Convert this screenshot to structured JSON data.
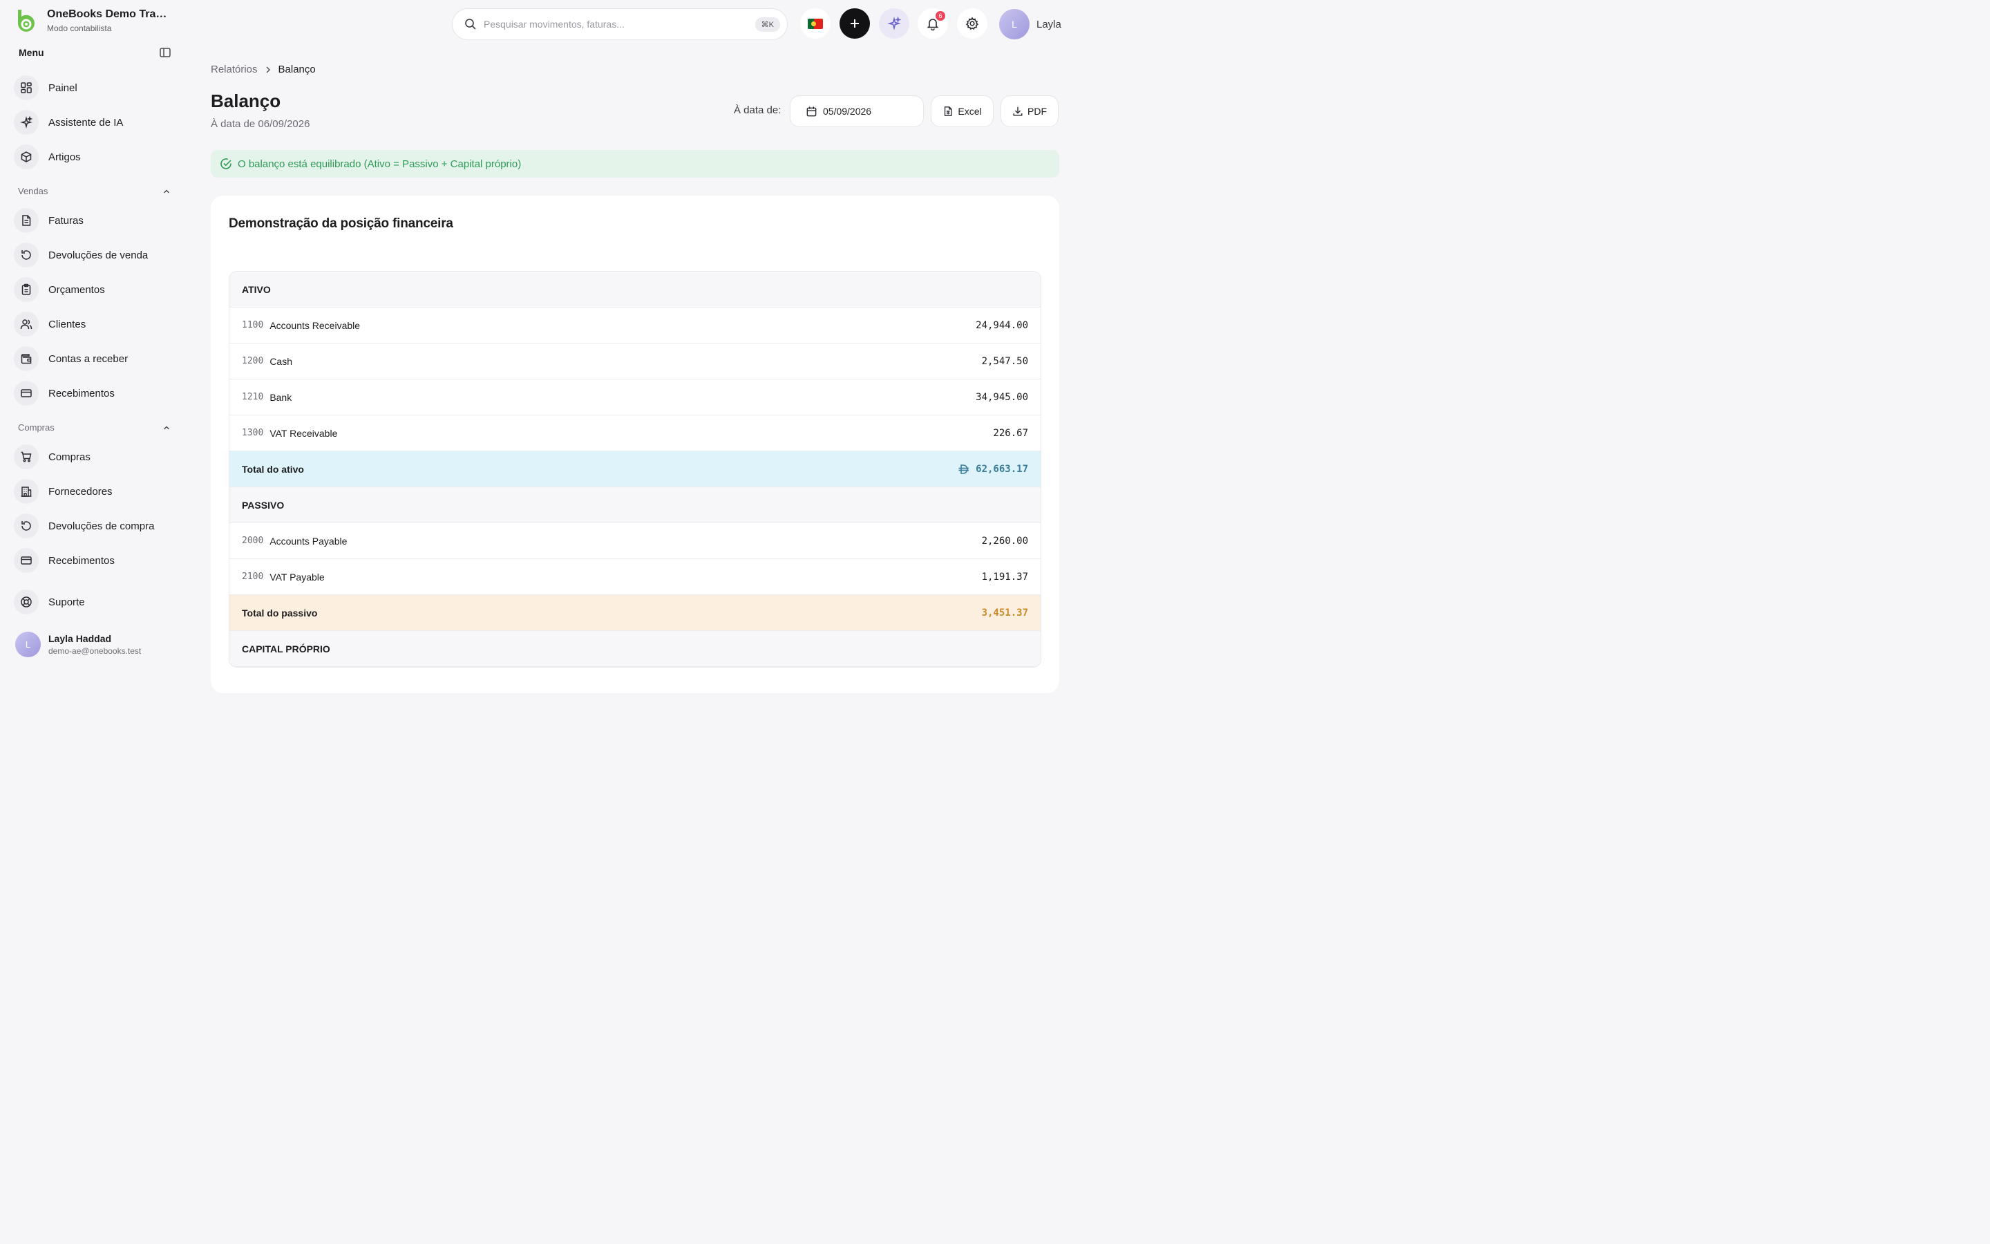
{
  "colors": {
    "brand": "#6cc24a",
    "accent_dark": "#121214",
    "success": "#2d9a55",
    "total_assets": "#3a7d98",
    "total_liabilities": "#c98a2a"
  },
  "brand": {
    "name": "OneBooks Demo Tradin...",
    "mode": "Modo contabilista"
  },
  "sidebar": {
    "menu_label": "Menu",
    "top_items": [
      {
        "label": "Painel",
        "icon": "dashboard-icon"
      },
      {
        "label": "Assistente de IA",
        "icon": "sparkle-icon"
      },
      {
        "label": "Artigos",
        "icon": "box-icon"
      }
    ],
    "sales": {
      "label": "Vendas",
      "items": [
        {
          "label": "Faturas",
          "icon": "document-icon"
        },
        {
          "label": "Devoluções de venda",
          "icon": "rotate-icon"
        },
        {
          "label": "Orçamentos",
          "icon": "clipboard-icon"
        },
        {
          "label": "Clientes",
          "icon": "users-icon"
        },
        {
          "label": "Contas a receber",
          "icon": "wallet-icon"
        },
        {
          "label": "Recebimentos",
          "icon": "credit-card-icon"
        }
      ]
    },
    "purchases": {
      "label": "Compras",
      "items": [
        {
          "label": "Compras",
          "icon": "cart-icon"
        },
        {
          "label": "Fornecedores",
          "icon": "building-icon"
        },
        {
          "label": "Devoluções de compra",
          "icon": "rotate-icon"
        },
        {
          "label": "Recebimentos",
          "icon": "credit-card-icon"
        }
      ]
    },
    "support": {
      "label": "Suporte",
      "icon": "lifebuoy-icon"
    },
    "user": {
      "initial": "L",
      "name": "Layla Haddad",
      "email": "demo-ae@onebooks.test"
    }
  },
  "topbar": {
    "search_placeholder": "Pesquisar movimentos, faturas...",
    "shortcut": "⌘K",
    "notifications_count": "6",
    "user_initial": "L",
    "user_name": "Layla"
  },
  "breadcrumb": {
    "parent": "Relatórios",
    "current": "Balanço"
  },
  "page": {
    "title": "Balanço",
    "subtitle": "À data de 06/09/2026"
  },
  "toolbar": {
    "date_label": "À data de:",
    "date_value": "05/09/2026",
    "excel_label": "Excel",
    "pdf_label": "PDF"
  },
  "alert": {
    "text": "O balanço está equilibrado (Ativo = Passivo + Capital próprio)"
  },
  "report": {
    "title": "Demonstração da posição financeira",
    "assets": {
      "heading": "ATIVO",
      "rows": [
        {
          "code": "1100",
          "name": "Accounts Receivable",
          "amount": "24,944.00"
        },
        {
          "code": "1200",
          "name": "Cash",
          "amount": "2,547.50"
        },
        {
          "code": "1210",
          "name": "Bank",
          "amount": "34,945.00"
        },
        {
          "code": "1300",
          "name": "VAT Receivable",
          "amount": "226.67"
        }
      ],
      "total_label": "Total do ativo",
      "total_amount": "62,663.17"
    },
    "liabilities": {
      "heading": "PASSIVO",
      "rows": [
        {
          "code": "2000",
          "name": "Accounts Payable",
          "amount": "2,260.00"
        },
        {
          "code": "2100",
          "name": "VAT Payable",
          "amount": "1,191.37"
        }
      ],
      "total_label": "Total do passivo",
      "total_amount": "3,451.37"
    },
    "equity": {
      "heading": "CAPITAL PRÓPRIO"
    }
  }
}
